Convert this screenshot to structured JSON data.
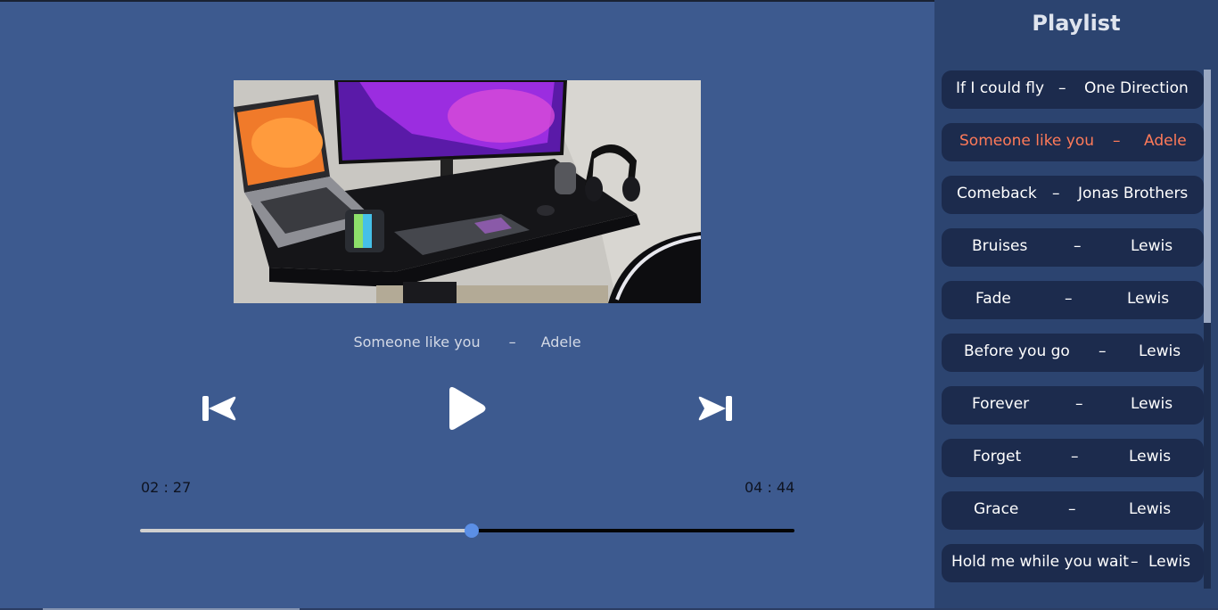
{
  "now_playing": {
    "title": "Someone like you",
    "separator": "–",
    "artist": "Adele"
  },
  "controls": {
    "prev_icon": "skip-previous-icon",
    "play_icon": "play-icon",
    "next_icon": "skip-next-icon"
  },
  "progress": {
    "current": "02 : 27",
    "duration": "04 : 44",
    "fraction": 0.507
  },
  "playlist": {
    "title": "Playlist",
    "items": [
      {
        "title": "If I could fly",
        "separator": "–",
        "artist": "One Direction",
        "active": false
      },
      {
        "title": "Someone like you",
        "separator": "–",
        "artist": "Adele",
        "active": true
      },
      {
        "title": "Comeback",
        "separator": "–",
        "artist": "Jonas Brothers",
        "active": false
      },
      {
        "title": "Bruises",
        "separator": "–",
        "artist": "Lewis",
        "active": false
      },
      {
        "title": "Fade",
        "separator": "–",
        "artist": "Lewis",
        "active": false
      },
      {
        "title": "Before you go",
        "separator": "–",
        "artist": "Lewis",
        "active": false
      },
      {
        "title": "Forever",
        "separator": "–",
        "artist": "Lewis",
        "active": false
      },
      {
        "title": "Forget",
        "separator": "–",
        "artist": "Lewis",
        "active": false
      },
      {
        "title": "Grace",
        "separator": "–",
        "artist": "Lewis",
        "active": false
      },
      {
        "title": "Hold me while you wait",
        "separator": "–",
        "artist": "Lewis",
        "active": false
      }
    ]
  },
  "colors": {
    "background": "#3d5a8f",
    "panel": "#2c4470",
    "item": "#1c2b4d",
    "active": "#ff7a59",
    "knob": "#5b8fe6"
  }
}
